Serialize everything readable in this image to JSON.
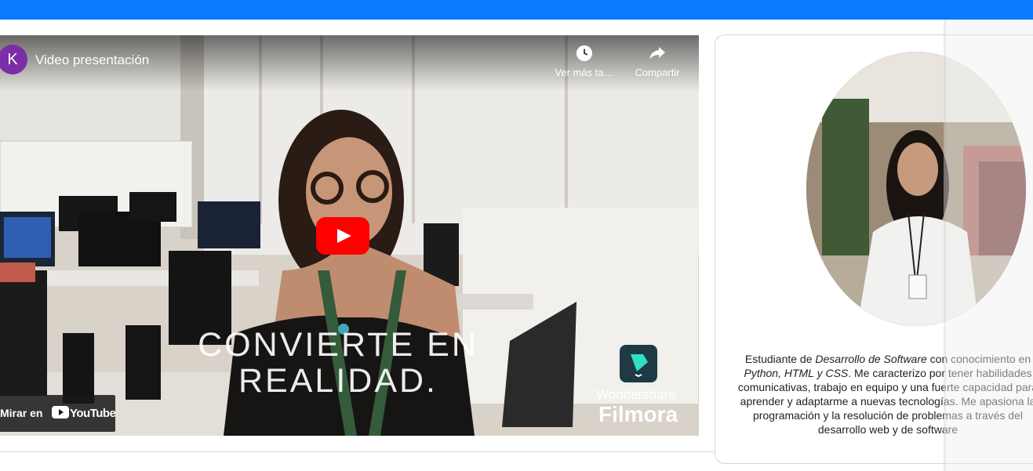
{
  "colors": {
    "top_bar": "#0a7bff",
    "play_button": "#ff0000"
  },
  "video": {
    "channel_initial": "K",
    "title": "Video presentación",
    "watch_later_label": "Ver más ta…",
    "share_label": "Compartir",
    "overlay_line1": "CONVIERTE EN",
    "overlay_line2": "REALIDAD.",
    "watch_on_label": "Mirar en",
    "youtube_wordmark": "YouTube",
    "filmora_brand": "Wondershare",
    "filmora_name": "Filmora"
  },
  "profile": {
    "bio_parts": {
      "p1": "Estudiante de ",
      "p2": "Desarrollo de Software",
      "p3": " con conocimiento en ",
      "p4": "Python, HTML y CSS",
      "p5": ". Me caracterizo por tener habilidades comunicativas, trabajo en equipo y una fuerte capacidad para aprender y adaptarme a nuevas tecnologías. Me apasiona la programación y la resolución de problemas a través del desarrollo web y de software"
    }
  }
}
